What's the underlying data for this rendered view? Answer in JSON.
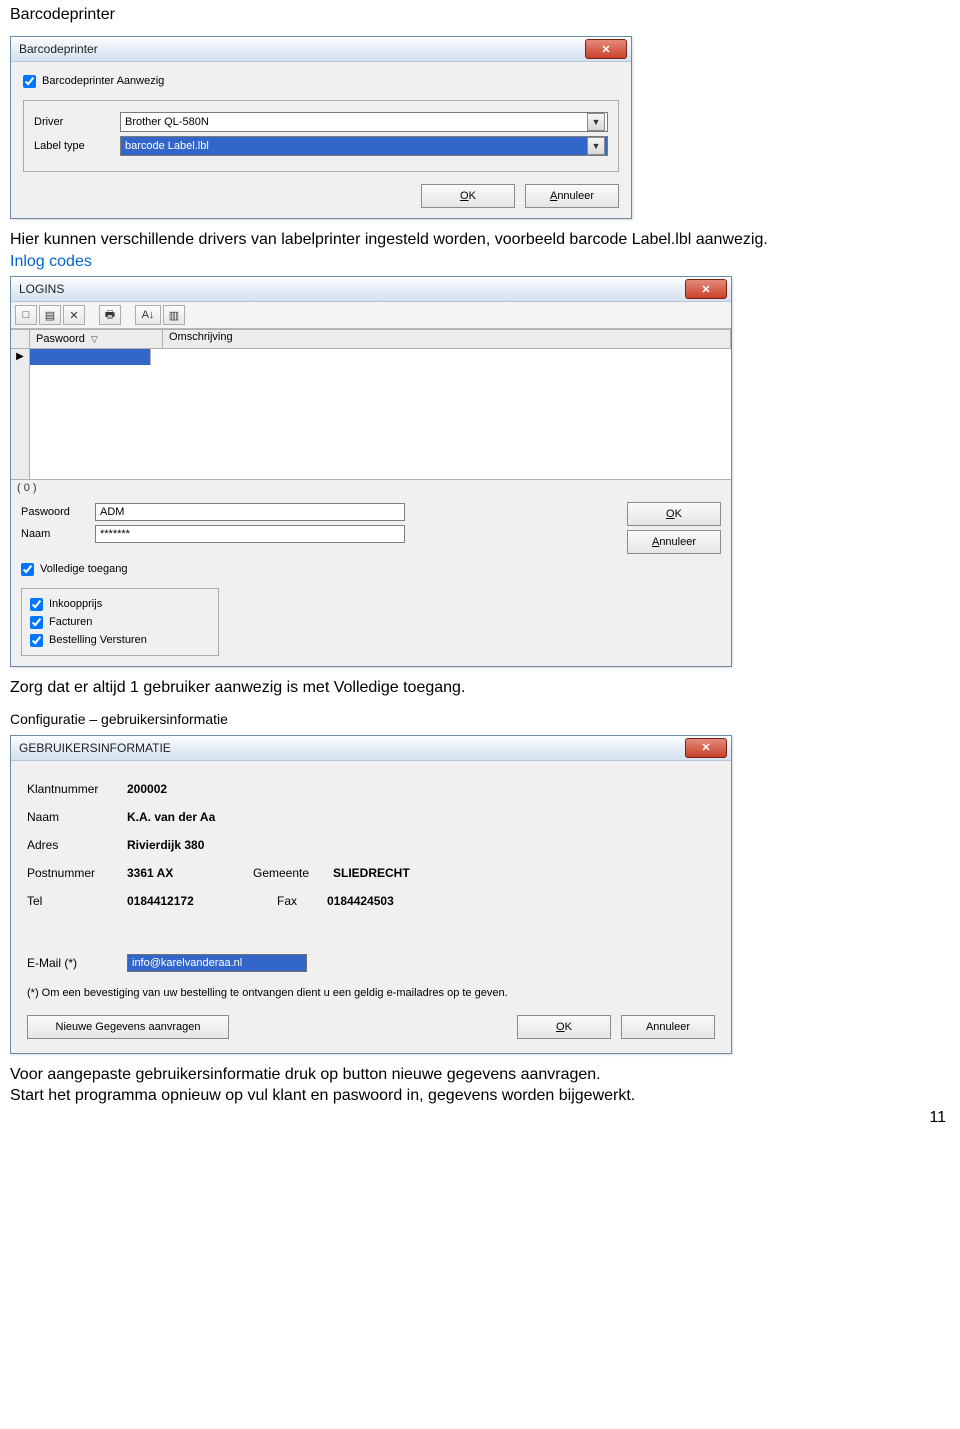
{
  "doc": {
    "h1": "Barcodeprinter",
    "p1": "Hier kunnen verschillende drivers van labelprinter ingesteld worden, voorbeeld barcode Label.lbl aanwezig.",
    "p1_link": "Inlog codes",
    "p2": "Zorg dat er altijd 1 gebruiker aanwezig is met Volledige toegang.",
    "p3": "Configuratie – gebruikersinformatie",
    "p4": "Voor aangepaste gebruikersinformatie druk op button nieuwe gegevens aanvragen.\nStart het programma opnieuw op vul klant en paswoord in, gegevens worden bijgewerkt.",
    "page_num": "11"
  },
  "barcode_dialog": {
    "title": "Barcodeprinter",
    "checkbox": "Barcodeprinter Aanwezig",
    "driver_lbl": "Driver",
    "label_lbl": "Label type",
    "driver_val": "Brother QL-580N",
    "label_val": "barcode Label.lbl",
    "ok": "OK",
    "ok_hot": "O",
    "annuleer": "Annuleer",
    "ann_hot": "A"
  },
  "logins_dialog": {
    "title": "LOGINS",
    "tool_new": "□",
    "tool_open": "▤",
    "tool_delete": "✕",
    "tool_print": "🖶",
    "tool_sort": "A↓",
    "tool_cols": "▥",
    "col1": "Paswoord",
    "col2": "Omschrijving",
    "counter": "( 0 )",
    "paswoord_lbl": "Paswoord",
    "paswoord_val": "ADM",
    "naam_lbl": "Naam",
    "naam_val": "*******",
    "ok": "OK",
    "annuleer": "Annuleer",
    "volledige": "Volledige toegang",
    "opt1": "Inkoopprijs",
    "opt2": "Facturen",
    "opt3": "Bestelling Versturen"
  },
  "info_dialog": {
    "title": "GEBRUIKERSINFORMATIE",
    "klant_lbl": "Klantnummer",
    "klant_val": "200002",
    "naam_lbl": "Naam",
    "naam_val": "K.A. van der  Aa",
    "adres_lbl": "Adres",
    "adres_val": "Rivierdijk 380",
    "post_lbl": "Postnummer",
    "post_val": "3361 AX",
    "gem_lbl": "Gemeente",
    "gem_val": "SLIEDRECHT",
    "tel_lbl": "Tel",
    "tel_val": "0184412172",
    "fax_lbl": "Fax",
    "fax_val": "0184424503",
    "email_lbl": "E-Mail (*)",
    "email_val": "info@karelvanderaa.nl",
    "note": "(*) Om een bevestiging van uw bestelling te ontvangen dient u een geldig e-mailadres op te geven.",
    "nieuw_btn": "Nieuwe Gegevens aanvragen",
    "ok": "OK",
    "annuleer": "Annuleer"
  }
}
